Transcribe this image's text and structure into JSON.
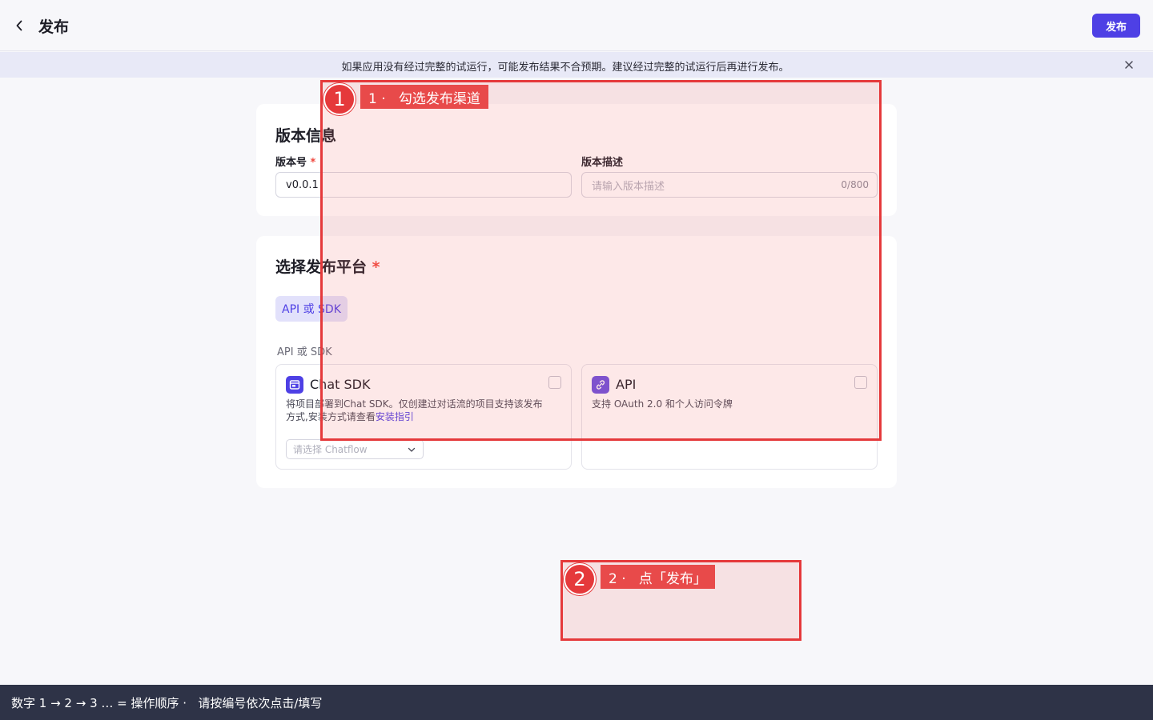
{
  "header": {
    "title": "发布",
    "publish_label": "发布"
  },
  "notice": {
    "text": "如果应用没有经过完整的试运行，可能发布结果不合预期。建议经过完整的试运行后再进行发布。"
  },
  "version_info": {
    "title": "版本信息",
    "version_label": "版本号",
    "required_mark": "*",
    "version_value": "v0.0.1",
    "desc_label": "版本描述",
    "desc_placeholder": "请输入版本描述",
    "desc_counter": "0/800"
  },
  "platform": {
    "title": "选择发布平台",
    "required_mark": "*",
    "tab_label": "API 或 SDK",
    "group_label": "API 或 SDK",
    "options": [
      {
        "title": "Chat SDK",
        "desc": "将项目部署到Chat SDK。仅创建过对话流的项目支持该发布方式,安装方式请查看",
        "link": "安装指引",
        "select_placeholder": "请选择 Chatflow",
        "icon": "chat-window-icon",
        "checked": false
      },
      {
        "title": "API",
        "desc": "支持 OAuth 2.0 和个人访问令牌",
        "icon": "link-icon",
        "checked": false
      }
    ]
  },
  "annotations": [
    {
      "number": "1",
      "label": "1 ·   勾选发布渠道"
    },
    {
      "number": "2",
      "label": "2 ·   点「发布」"
    }
  ],
  "footer": {
    "text": "数字 1 → 2 → 3 … = 操作顺序 ·   请按编号依次点击/填写"
  },
  "colors": {
    "accent": "#4e40e5",
    "annotation": "#e5393b",
    "footer_bg": "#2e3347"
  }
}
